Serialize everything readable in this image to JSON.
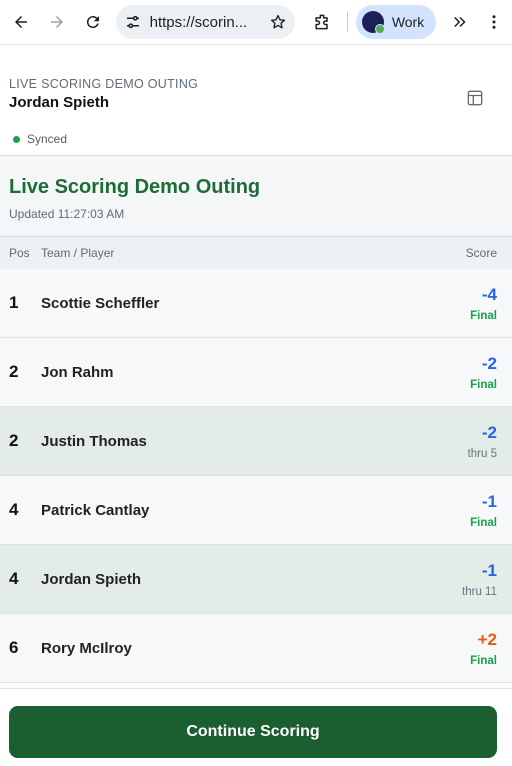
{
  "browser": {
    "url": "https://scorin...",
    "profile_label": "Work"
  },
  "header": {
    "outing_label": "LIVE SCORING DEMO OUTING",
    "player_name": "Jordan Spieth",
    "sync_status": "Synced"
  },
  "leaderboard": {
    "title": "Live Scoring Demo Outing",
    "updated": "Updated 11:27:03 AM",
    "columns": {
      "pos": "Pos",
      "name": "Team / Player",
      "score": "Score"
    },
    "rows": [
      {
        "pos": "1",
        "name": "Scottie Scheffler",
        "score": "-4",
        "status": "Final",
        "score_color": "#2563eb"
      },
      {
        "pos": "2",
        "name": "Jon Rahm",
        "score": "-2",
        "status": "Final",
        "score_color": "#2563eb"
      },
      {
        "pos": "2",
        "name": "Justin Thomas",
        "score": "-2",
        "status": "thru 5",
        "score_color": "#2563eb"
      },
      {
        "pos": "4",
        "name": "Patrick Cantlay",
        "score": "-1",
        "status": "Final",
        "score_color": "#2563eb"
      },
      {
        "pos": "4",
        "name": "Jordan Spieth",
        "score": "-1",
        "status": "thru 11",
        "score_color": "#2563eb"
      },
      {
        "pos": "6",
        "name": "Rory McIlroy",
        "score": "+2",
        "status": "Final",
        "score_color": "#ea580c"
      }
    ]
  },
  "footer": {
    "continue_label": "Continue Scoring"
  },
  "colors": {
    "brand_green": "#1b5e30",
    "title_green": "#1e6b36",
    "under_par": "#2563eb",
    "over_par": "#ea580c",
    "final": "#16a34a"
  },
  "icons": [
    "back-arrow-icon",
    "forward-arrow-icon",
    "reload-icon",
    "site-settings-icon",
    "star-icon",
    "extensions-icon",
    "profile-avatar-icon",
    "more-extensions-icon",
    "kebab-menu-icon",
    "layout-icon"
  ]
}
